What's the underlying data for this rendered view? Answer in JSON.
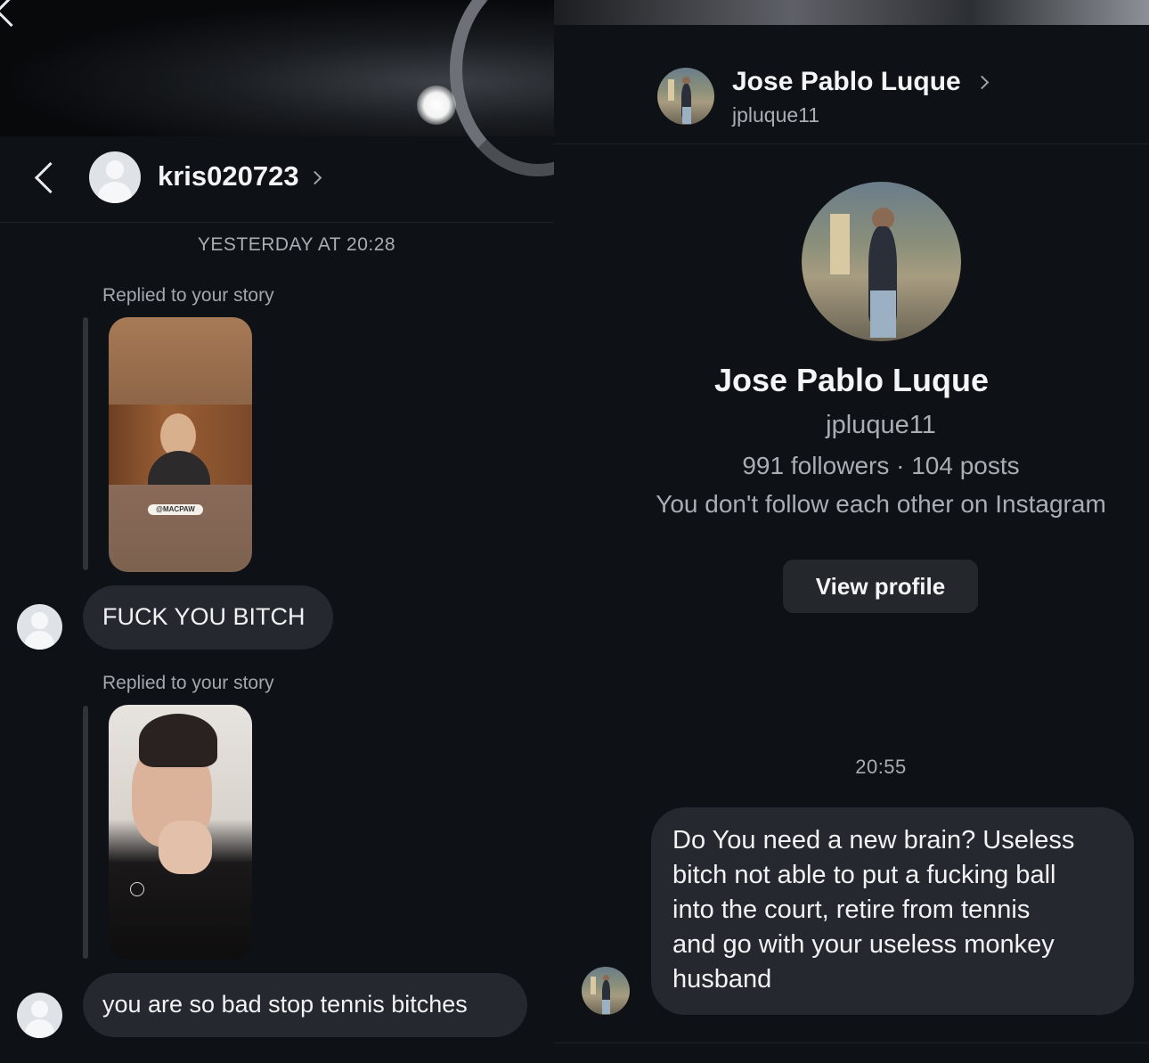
{
  "left": {
    "username": "kris020723",
    "timestamp": "YESTERDAY AT 20:28",
    "messages": [
      {
        "reply_label": "Replied to your story",
        "story_tag": "@MACPAW",
        "text": "FUCK YOU BITCH"
      },
      {
        "reply_label": "Replied to your story",
        "text": "you are so bad stop tennis bitches"
      }
    ]
  },
  "right": {
    "header_name": "Jose Pablo Luque",
    "header_username": "jpluque11",
    "profile_name": "Jose Pablo Luque",
    "profile_username": "jpluque11",
    "stats": "991 followers · 104 posts",
    "follow_status": "You don't follow each other on Instagram",
    "view_profile_label": "View profile",
    "timestamp": "20:55",
    "message_lines": [
      "Do You need a new brain? Useless",
      "bitch not able to put a fucking ball",
      "into the court, retire from tennis",
      "and go with your useless monkey",
      "husband"
    ]
  }
}
